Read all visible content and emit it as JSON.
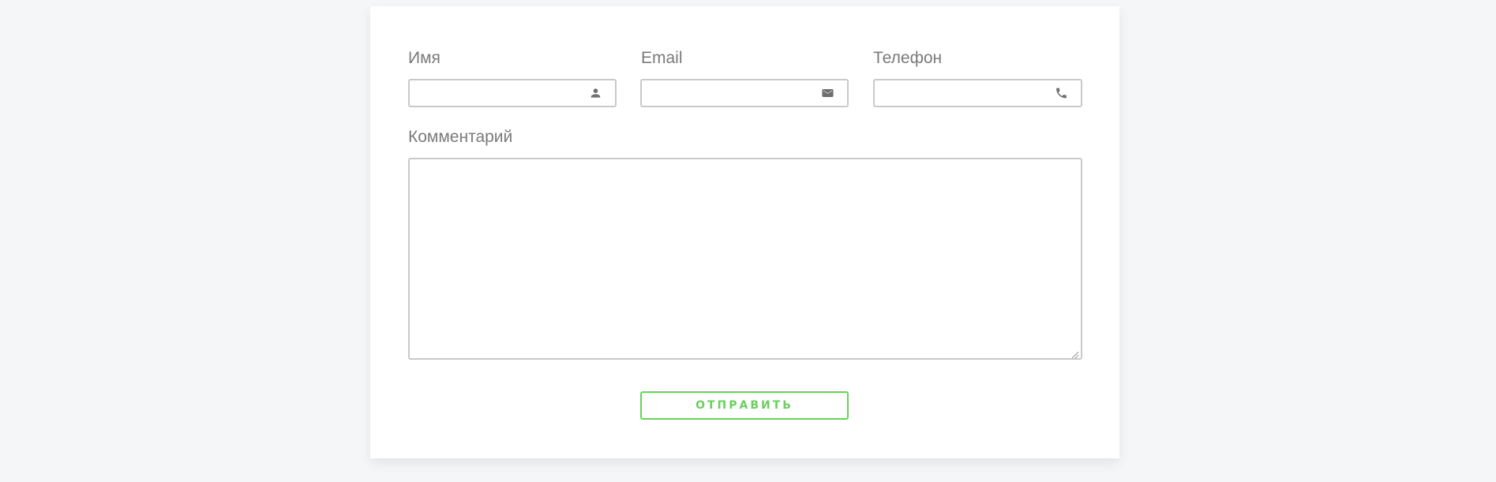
{
  "form": {
    "name": {
      "label": "Имя",
      "value": "",
      "icon": "person-icon"
    },
    "email": {
      "label": "Email",
      "value": "",
      "icon": "envelope-icon"
    },
    "phone": {
      "label": "Телефон",
      "value": "",
      "icon": "phone-icon"
    },
    "comment": {
      "label": "Комментарий",
      "value": ""
    },
    "submit_label": "ОТПРАВИТЬ"
  },
  "colors": {
    "accent": "#6bcf5f",
    "label": "#7a7a7a",
    "border": "#c9c9c9",
    "icon": "#6f6f6f",
    "page_background": "#f5f6f8",
    "card_background": "#ffffff"
  }
}
